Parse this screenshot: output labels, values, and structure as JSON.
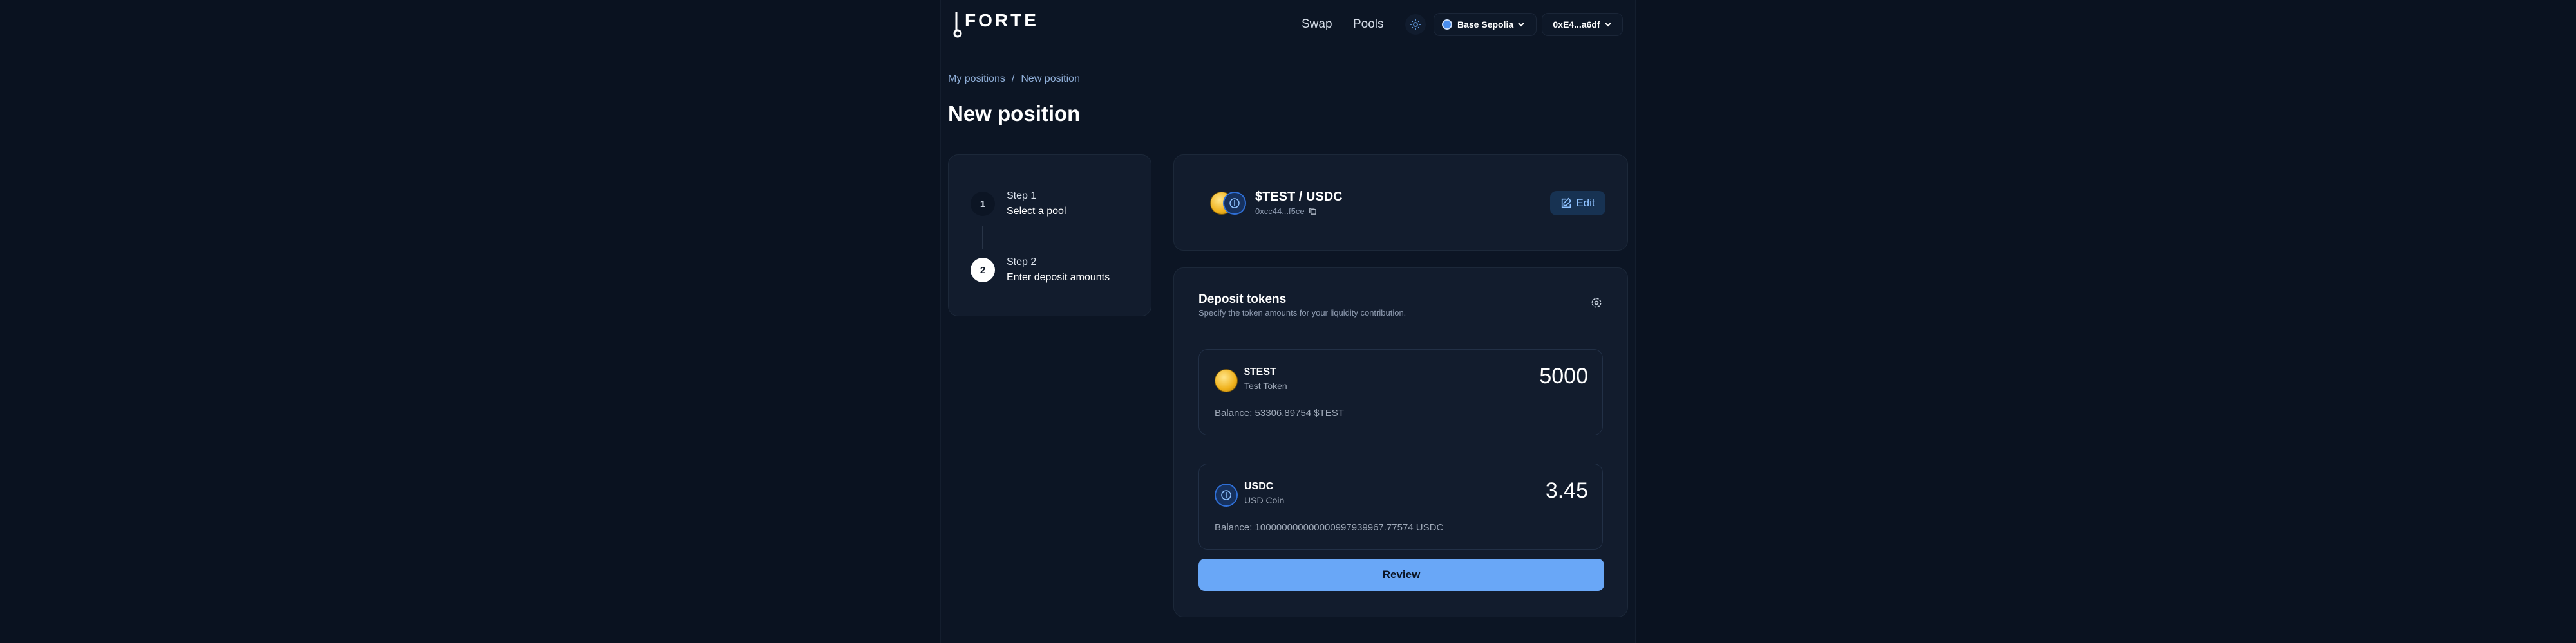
{
  "header": {
    "logo_text": "FORTE",
    "nav": {
      "swap": "Swap",
      "pools": "Pools"
    },
    "network_label": "Base Sepolia",
    "wallet_label": "0xE4...a6df"
  },
  "breadcrumb": {
    "root": "My positions",
    "separator": "/",
    "current": "New position"
  },
  "page_title": "New position",
  "steps": [
    {
      "number": "1",
      "label": "Step 1",
      "description": "Select a pool",
      "active": false
    },
    {
      "number": "2",
      "label": "Step 2",
      "description": "Enter deposit amounts",
      "active": true
    }
  ],
  "pool": {
    "pair_name": "$TEST / USDC",
    "address": "0xcc44...f5ce",
    "edit_label": "Edit"
  },
  "deposit": {
    "title": "Deposit tokens",
    "subtitle": "Specify the token amounts for your liquidity contribution.",
    "tokens": [
      {
        "symbol": "$TEST",
        "name": "Test Token",
        "amount": "5000",
        "balance": "Balance: 53306.89754 $TEST"
      },
      {
        "symbol": "USDC",
        "name": "USD Coin",
        "amount": "3.45",
        "balance": "Balance: 100000000000000997939967.77574 USDC"
      }
    ],
    "review_label": "Review"
  },
  "colors": {
    "accent": "#69a7f7",
    "background": "#0a1220",
    "card": "#121c2d"
  }
}
